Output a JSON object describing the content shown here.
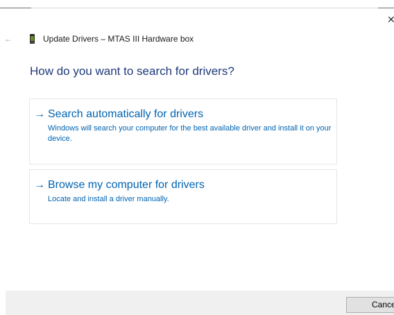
{
  "window": {
    "title": "Update Drivers – MTAS III Hardware box",
    "close_glyph": "✕",
    "back_glyph": "←"
  },
  "main": {
    "heading": "How do you want to search for drivers?",
    "options": [
      {
        "title": "Search automatically for drivers",
        "description": "Windows will search your computer for the best available driver and install it on your device."
      },
      {
        "title": "Browse my computer for drivers",
        "description": "Locate and install a driver manually."
      }
    ],
    "arrow_glyph": "→"
  },
  "footer": {
    "cancel_label": "Cancel"
  },
  "colors": {
    "link": "#0063b1",
    "heading": "#1f3a7a",
    "footer_bg": "#f0f0f0"
  },
  "icons": {
    "back": "back-arrow-icon",
    "device": "hardware-device-icon",
    "close": "close-icon",
    "option_arrow": "arrow-right-icon"
  }
}
